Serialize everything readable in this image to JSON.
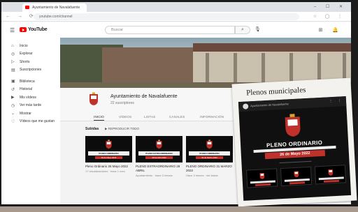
{
  "browser": {
    "tab_title": "Ayuntamiento de Navalafuente",
    "url": "youtube.com/channel",
    "nav_glyphs": "← → ⟳",
    "ext_glyphs": "☆ ◯ ⋮",
    "win_ctrls": "– ☐ ✕"
  },
  "youtube": {
    "logo": "YouTube",
    "search_placeholder": "Buscar",
    "search_icon": "search-icon",
    "header_right": "⊞ 🔔"
  },
  "sidebar": {
    "items": [
      {
        "icon": "⌂",
        "label": "Inicio"
      },
      {
        "icon": "◎",
        "label": "Explorar"
      },
      {
        "icon": "▷",
        "label": "Shorts"
      },
      {
        "icon": "▤",
        "label": "Suscripciones"
      }
    ],
    "items2": [
      {
        "icon": "▣",
        "label": "Biblioteca"
      },
      {
        "icon": "↺",
        "label": "Historial"
      },
      {
        "icon": "▶",
        "label": "Mis vídeos"
      },
      {
        "icon": "◷",
        "label": "Ver más tarde"
      },
      {
        "icon": "⌄",
        "label": "Mostrar"
      },
      {
        "icon": "♡",
        "label": "Vídeos que me gustan"
      }
    ]
  },
  "channel": {
    "name": "Ayuntamiento de Navalafuente",
    "subscribers": "22 suscriptores",
    "tabs": [
      "INICIO",
      "VÍDEOS",
      "LISTAS",
      "CANALES",
      "INFORMACIÓN",
      "Q"
    ],
    "section_title": "Subidas",
    "play_all": "▶  REPRODUCIR TODO"
  },
  "videos": [
    {
      "title": "Pleno Ordinario 26 Mayo 2022",
      "meta": "17 visualizaciones · hace 1 mes",
      "band": "PLENO ORDINARIO",
      "date": "26 de Mayo 2022"
    },
    {
      "title": "PLENO EXTRAORDINARIO 28 ABRIL",
      "meta": "Ayuntamiento · hace 2 meses",
      "band": "PLENO EXTRAORDINARIO",
      "date": "28 de Abril 2022"
    },
    {
      "title": "PLENO ORDINARIO 31 MARZO 2022",
      "meta": "Hace 3 meses · sin vistas",
      "band": "PLENO ORDINARIO",
      "date": "31 de Marzo 2022"
    }
  ],
  "clipping": {
    "title": "Plenos municipales",
    "channel": "Ayuntamiento de Navalafuente",
    "pleno": "PLENO ORDINARIO",
    "date": "26 de Mayo 2022"
  },
  "colors": {
    "accent_red": "#c0312b",
    "youtube_red": "#ff0000"
  }
}
